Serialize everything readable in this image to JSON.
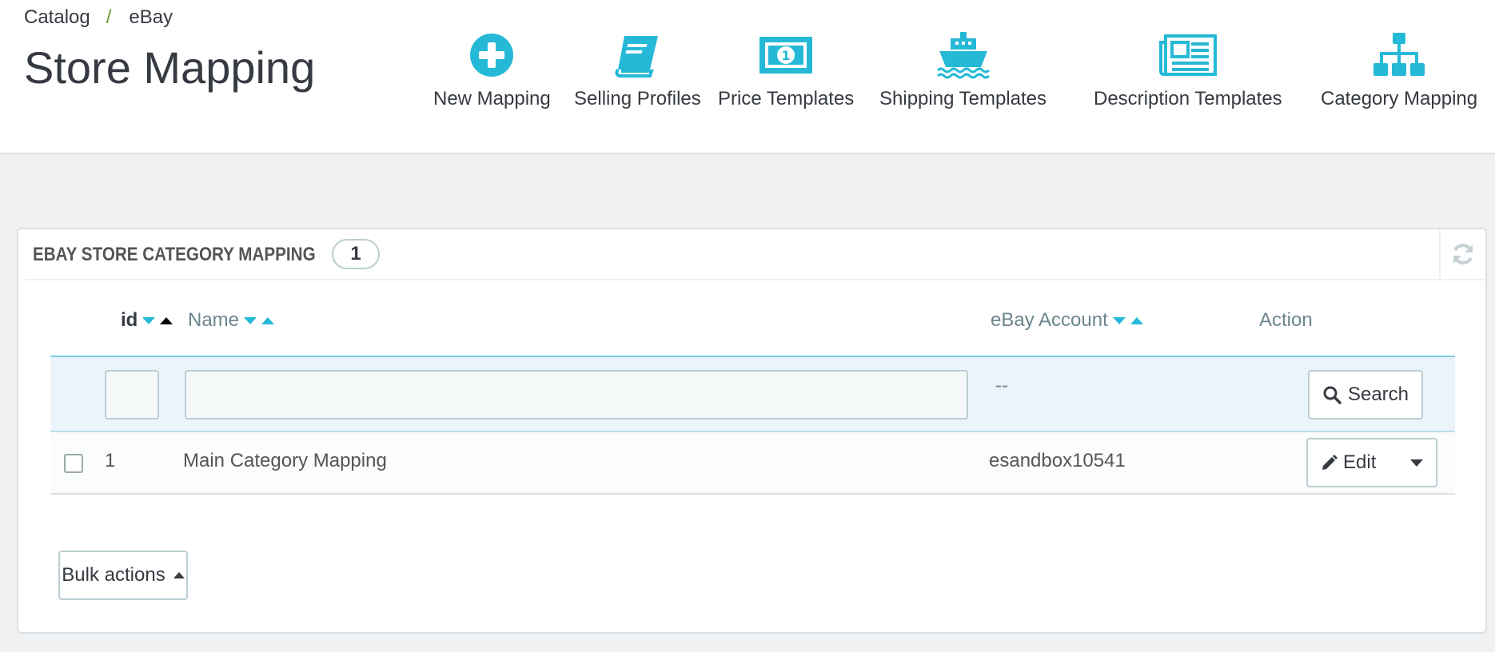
{
  "breadcrumb": {
    "items": [
      "Catalog",
      "eBay"
    ],
    "separator": "/"
  },
  "page": {
    "title": "Store Mapping"
  },
  "toolbar": {
    "accent": "#25b9d7",
    "buttons": [
      {
        "label": "New Mapping",
        "icon": "plus-circle-icon"
      },
      {
        "label": "Selling Profiles",
        "icon": "book-icon"
      },
      {
        "label": "Price Templates",
        "icon": "money-icon"
      },
      {
        "label": "Shipping Templates",
        "icon": "ship-icon"
      },
      {
        "label": "Description Templates",
        "icon": "newspaper-icon"
      },
      {
        "label": "Category Mapping",
        "icon": "sitemap-icon"
      }
    ]
  },
  "panel": {
    "title": "EBAY STORE CATEGORY MAPPING",
    "count": "1",
    "columns": {
      "id": "id",
      "name": "Name",
      "account": "eBay Account",
      "action": "Action"
    },
    "filter": {
      "id_value": "",
      "name_value": "",
      "account_value": "--",
      "search_label": "Search"
    },
    "rows": [
      {
        "id": "1",
        "name": "Main Category Mapping",
        "account": "esandbox10541",
        "action_label": "Edit"
      }
    ],
    "bulk_label": "Bulk actions"
  }
}
